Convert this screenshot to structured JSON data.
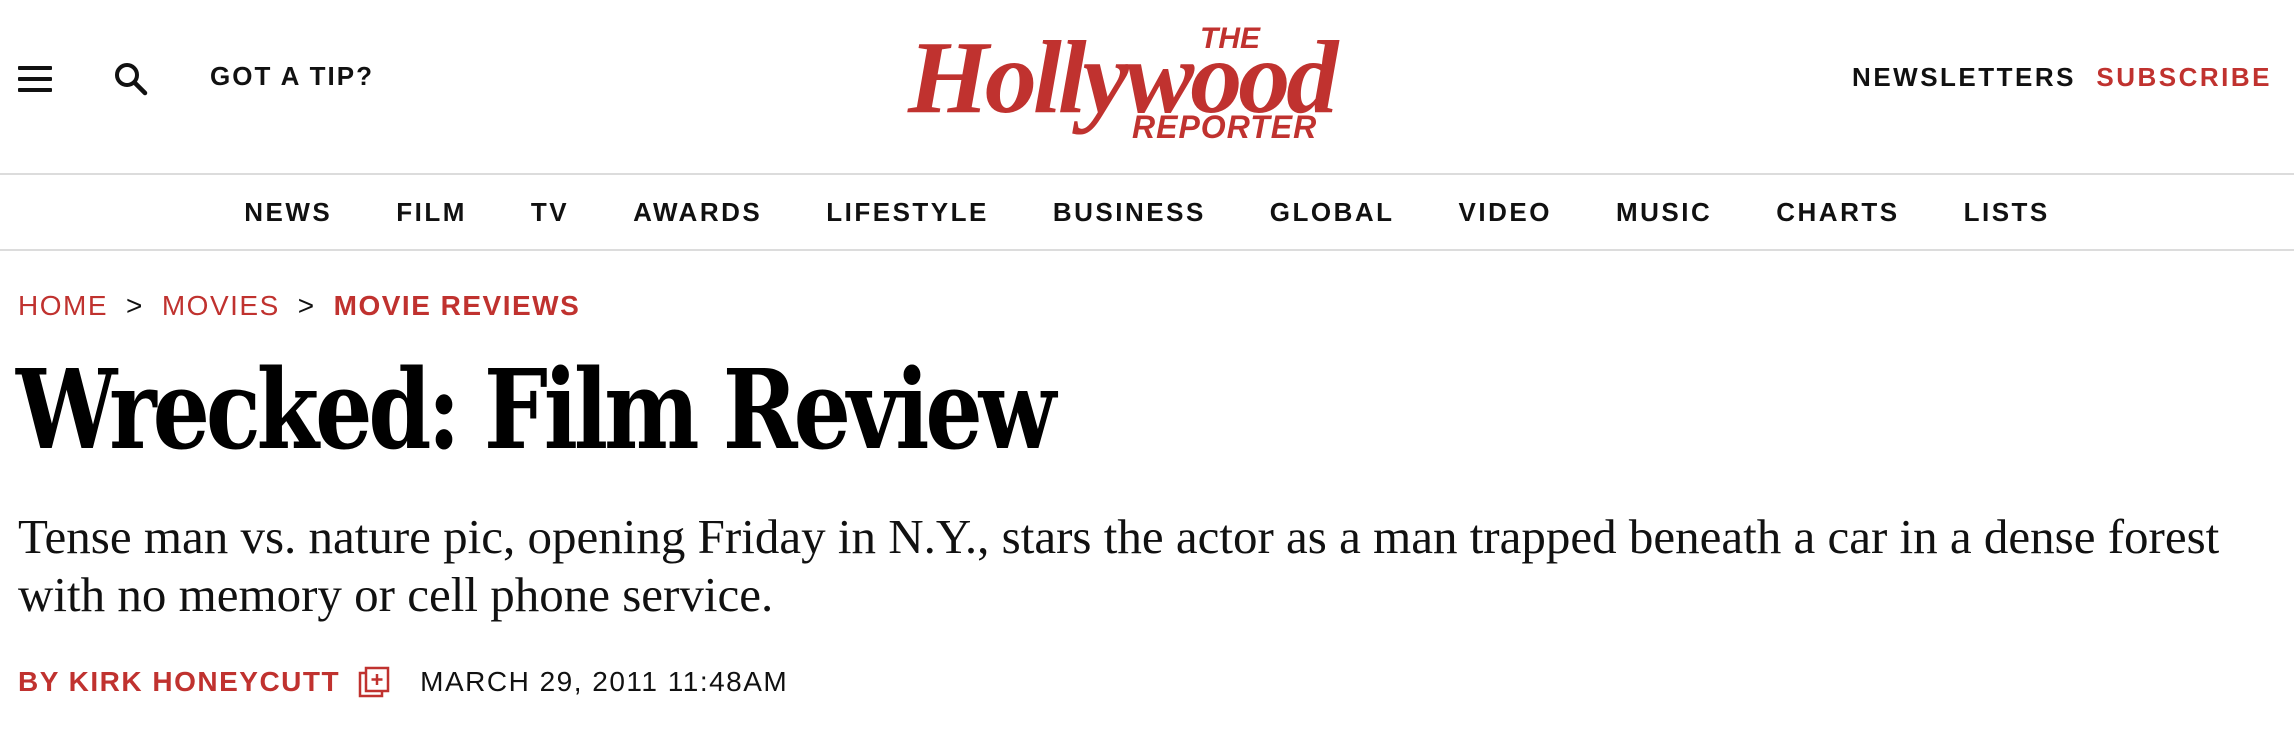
{
  "header": {
    "menu_icon": "hamburger-menu-icon",
    "search_icon": "search-icon",
    "tip_label": "GOT A TIP?",
    "logo": {
      "top_word": "THE",
      "main_word": "Hollywood",
      "bottom_word": "REPORTER",
      "color": "#c0322f"
    },
    "newsletters_label": "NEWSLETTERS",
    "subscribe_label": "SUBSCRIBE"
  },
  "nav": {
    "items": [
      "NEWS",
      "FILM",
      "TV",
      "AWARDS",
      "LIFESTYLE",
      "BUSINESS",
      "GLOBAL",
      "VIDEO",
      "MUSIC",
      "CHARTS",
      "LISTS"
    ]
  },
  "breadcrumb": {
    "items": [
      "HOME",
      "MOVIES",
      "MOVIE REVIEWS"
    ],
    "separator": ">"
  },
  "article": {
    "title": "Wrecked: Film Review",
    "dek": "Tense man vs. nature pic, opening Friday in N.Y., stars the actor as a man trapped beneath a car in a dense forest with no memory or cell phone service.",
    "byline": "BY KIRK HONEYCUTT",
    "author_icon": "author-more-icon",
    "date": "MARCH 29, 2011 11:48AM"
  },
  "colors": {
    "accent": "#c0322f",
    "text": "#111111",
    "divider": "#dcdcdc"
  }
}
